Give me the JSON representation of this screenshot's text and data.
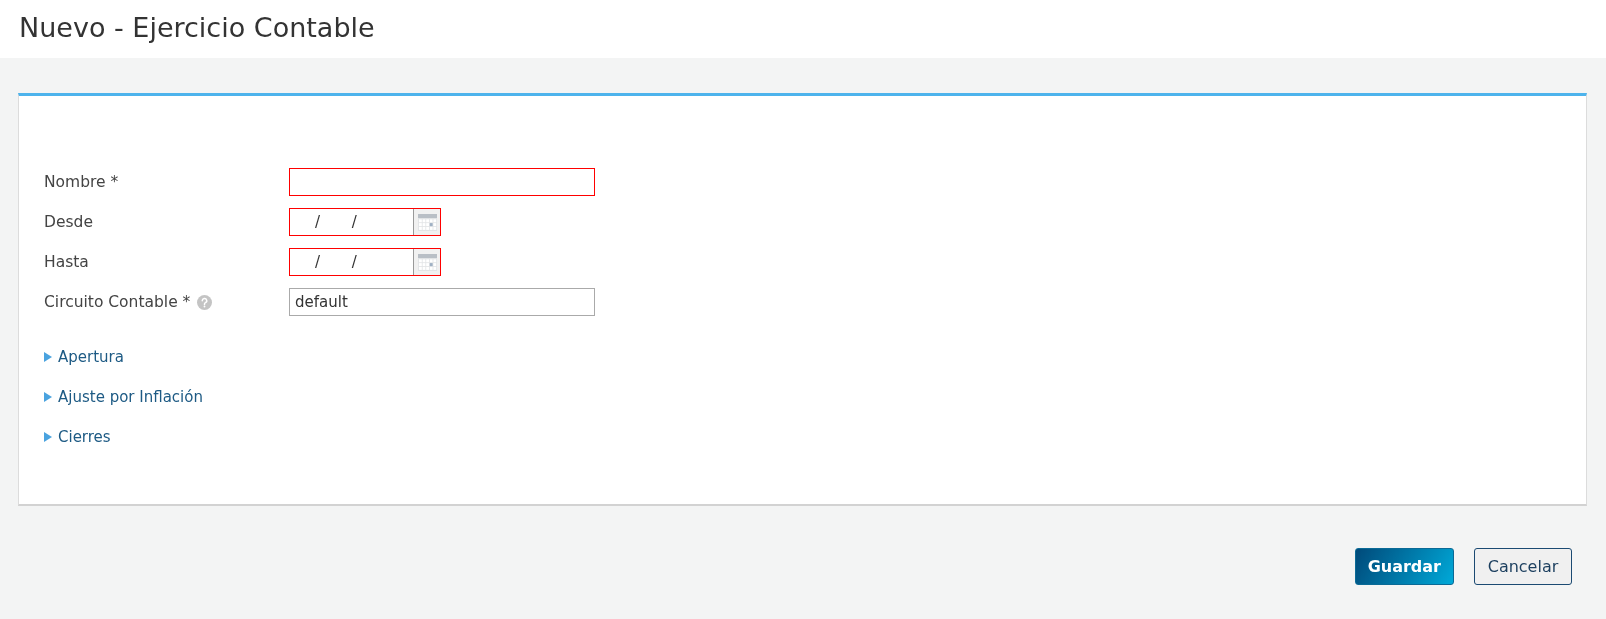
{
  "page": {
    "title": "Nuevo - Ejercicio Contable"
  },
  "fields": [
    {
      "kind": "text",
      "label": "Nombre *",
      "help": false,
      "invalid": true
    },
    {
      "kind": "date",
      "label": "Desde",
      "help": false,
      "mask": "/ /",
      "invalid": true
    },
    {
      "kind": "date",
      "label": "Hasta",
      "help": false,
      "mask": "/ /",
      "invalid": true
    },
    {
      "kind": "text",
      "label": "Circuito Contable *",
      "help": true,
      "value": "default",
      "invalid": false
    }
  ],
  "sections": [
    {
      "label": "Apertura",
      "expanded": false
    },
    {
      "label": "Ajuste por Inflación",
      "expanded": false
    },
    {
      "label": "Cierres",
      "expanded": false
    }
  ],
  "buttons": [
    {
      "kind": "primary",
      "label": "Guardar"
    },
    {
      "kind": "secondary",
      "label": "Cancelar"
    }
  ]
}
